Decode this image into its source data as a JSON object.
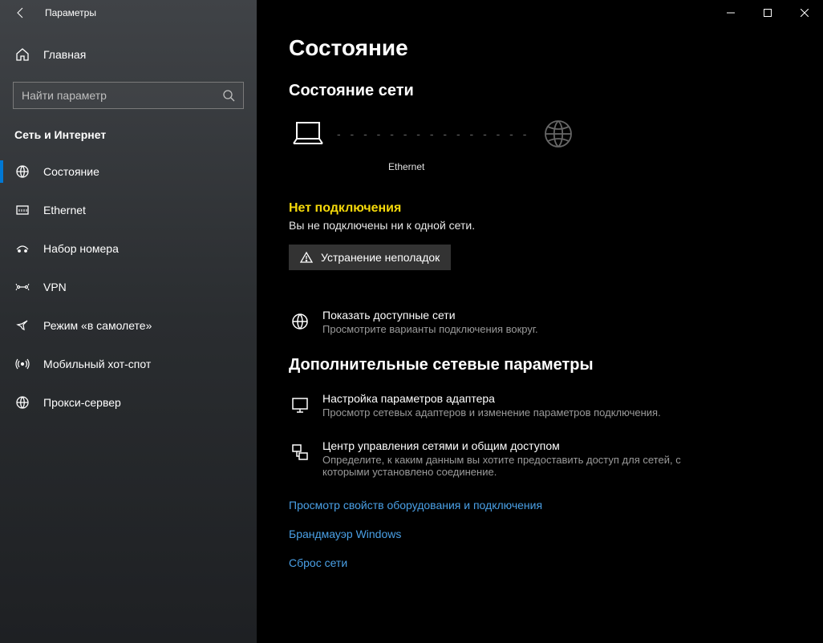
{
  "window_title": "Параметры",
  "home_label": "Главная",
  "search_placeholder": "Найти параметр",
  "category": "Сеть и Интернет",
  "nav": [
    {
      "label": "Состояние"
    },
    {
      "label": "Ethernet"
    },
    {
      "label": "Набор номера"
    },
    {
      "label": "VPN"
    },
    {
      "label": "Режим «в самолете»"
    },
    {
      "label": "Мобильный хот-спот"
    },
    {
      "label": "Прокси-сервер"
    }
  ],
  "page_title": "Состояние",
  "section_status": "Состояние сети",
  "diagram_label": "Ethernet",
  "warn_title": "Нет подключения",
  "warn_desc": "Вы не подключены ни к одной сети.",
  "troubleshoot_label": "Устранение неполадок",
  "available": {
    "title": "Показать доступные сети",
    "desc": "Просмотрите варианты подключения вокруг."
  },
  "advanced_heading": "Дополнительные сетевые параметры",
  "adapter": {
    "title": "Настройка параметров адаптера",
    "desc": "Просмотр сетевых адаптеров и изменение параметров подключения."
  },
  "sharing": {
    "title": "Центр управления сетями и общим доступом",
    "desc": "Определите, к каким данным вы хотите предоставить доступ для сетей, с которыми установлено соединение."
  },
  "links": [
    "Просмотр свойств оборудования и подключения",
    "Брандмауэр Windows",
    "Сброс сети"
  ]
}
